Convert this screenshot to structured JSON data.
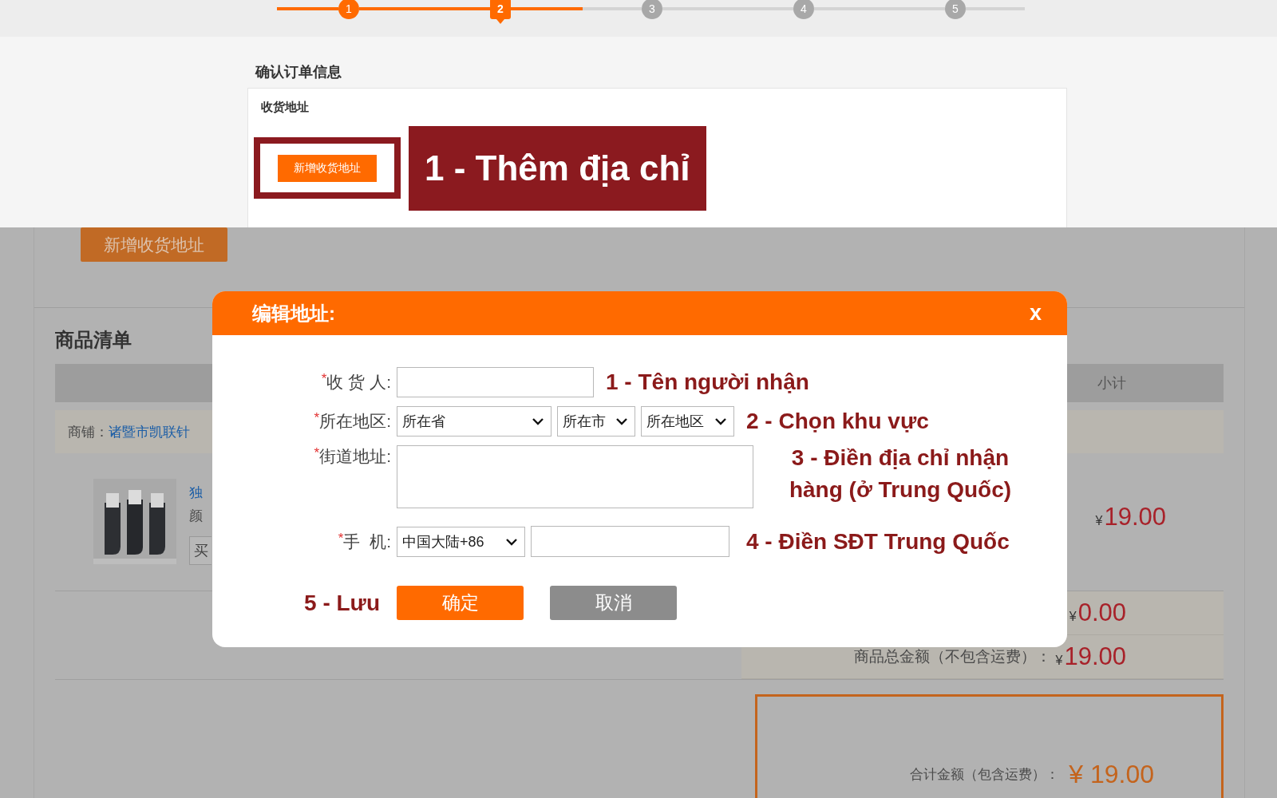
{
  "stepper": {
    "steps": [
      {
        "number": "1",
        "completed": true,
        "selected": false
      },
      {
        "number": "2",
        "completed": true,
        "selected": true
      },
      {
        "number": "3",
        "completed": false,
        "selected": false
      },
      {
        "number": "4",
        "completed": false,
        "selected": false
      },
      {
        "number": "5",
        "completed": false,
        "selected": false
      }
    ]
  },
  "confirm": {
    "title": "确认订单信息",
    "address_label": "收货地址",
    "add_button": "新增收货地址",
    "callout": "1 - Thêm địa chỉ"
  },
  "background_page": {
    "add_button": "新增收货地址",
    "section_title": "商品清单",
    "column_subtotal": "小计",
    "shop_label": "商铺：",
    "shop_name": "诸暨市凯联针",
    "product_title": "独",
    "product_spec": "颜",
    "product_button": "买",
    "price_currency": "¥",
    "price": "19.00",
    "shipping_currency": "¥",
    "shipping": "0.00",
    "goods_total_label": "商品总金额（不包含运费）：",
    "goods_total_currency": "¥",
    "goods_total": "19.00",
    "grand_total_label": "合计金额（包含运费）：",
    "grand_total_currency": "¥",
    "grand_total": "19.00"
  },
  "dialog": {
    "title": "编辑地址:",
    "close": "x",
    "fields": [
      {
        "kind": "text",
        "required_mark": "*",
        "label": "收 货 人:",
        "annotation": "1 - Tên người nhận"
      },
      {
        "kind": "selects",
        "required_mark": "*",
        "label": "所在地区:",
        "selects": [
          "所在省",
          "所在市",
          "所在地区"
        ],
        "annotation": "2 - Chọn khu vực"
      },
      {
        "kind": "textarea",
        "required_mark": "*",
        "label": "街道地址:",
        "annotation": "3 - Điền địa chỉ nhận hàng (ở Trung Quốc)"
      },
      {
        "kind": "phone",
        "required_mark": "*",
        "label": "手  机:",
        "selects": [
          "中国大陆+86"
        ],
        "annotation": "4 - Điền SĐT Trung Quốc"
      }
    ],
    "actions_annotation": "5 - Lưu",
    "buttons": [
      {
        "kind": "primary",
        "label": "确定"
      },
      {
        "kind": "secondary",
        "label": "取消"
      }
    ]
  }
}
